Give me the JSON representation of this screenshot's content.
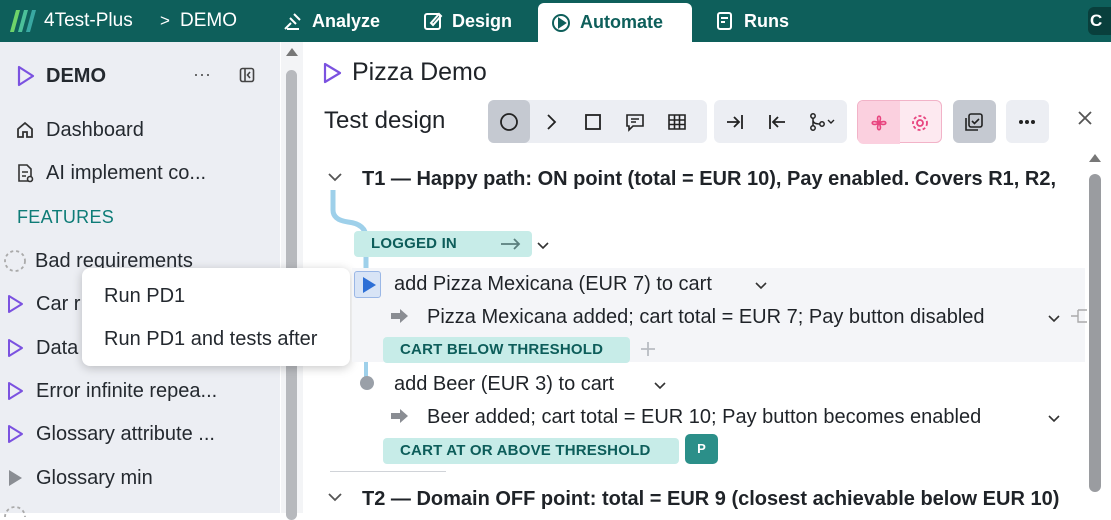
{
  "header": {
    "app_name": "4Test-Plus",
    "breadcrumb_sep": ">",
    "project": "DEMO",
    "tabs": [
      {
        "label": "Analyze",
        "icon": "analyze-icon"
      },
      {
        "label": "Design",
        "icon": "design-icon"
      },
      {
        "label": "Automate",
        "icon": "automate-icon",
        "active": true
      },
      {
        "label": "Runs",
        "icon": "runs-icon"
      }
    ],
    "avatar_initial": "C"
  },
  "sidebar": {
    "title": "DEMO",
    "more": "···",
    "nav": [
      {
        "label": "Dashboard",
        "icon": "home-icon"
      },
      {
        "label": "AI implement co...",
        "icon": "ai-implement-icon"
      }
    ],
    "section_label": "FEATURES",
    "features": [
      {
        "label": "Bad requirements",
        "icon": "dashed-circle-icon"
      },
      {
        "label": "Car r",
        "icon": "play-outline-icon"
      },
      {
        "label": "Data",
        "icon": "play-outline-icon"
      },
      {
        "label": "Error infinite repea...",
        "icon": "play-outline-icon"
      },
      {
        "label": "Glossary attribute ...",
        "icon": "play-outline-icon"
      },
      {
        "label": "Glossary min",
        "icon": "play-filled-gray-icon"
      }
    ]
  },
  "context_menu": {
    "items": [
      "Run PD1",
      "Run PD1 and tests after"
    ]
  },
  "main": {
    "title": "Pizza Demo",
    "section_label": "Test design",
    "tests": [
      {
        "title": "T1 — Happy path: ON point (total = EUR 10), Pay enabled. Covers R1, R2,",
        "start_state": "LOGGED IN",
        "steps": [
          {
            "action": "add Pizza Mexicana (EUR 7) to cart",
            "result": "Pizza Mexicana added; cart total = EUR 7; Pay button disabled",
            "state": "CART BELOW THRESHOLD"
          },
          {
            "action": "add Beer (EUR 3) to cart",
            "result": "Beer added; cart total = EUR 10; Pay button becomes enabled",
            "state": "CART AT OR ABOVE THRESHOLD",
            "badge": "P"
          }
        ]
      },
      {
        "title": "T2 — Domain OFF point: total = EUR 9 (closest achievable below EUR 10)"
      }
    ]
  },
  "colors": {
    "header_bg": "#0e5f5b",
    "accent": "#0e7c77",
    "state_bg": "#c7ece8",
    "play_purple": "#7b52e0",
    "pink": "#e8447f"
  }
}
